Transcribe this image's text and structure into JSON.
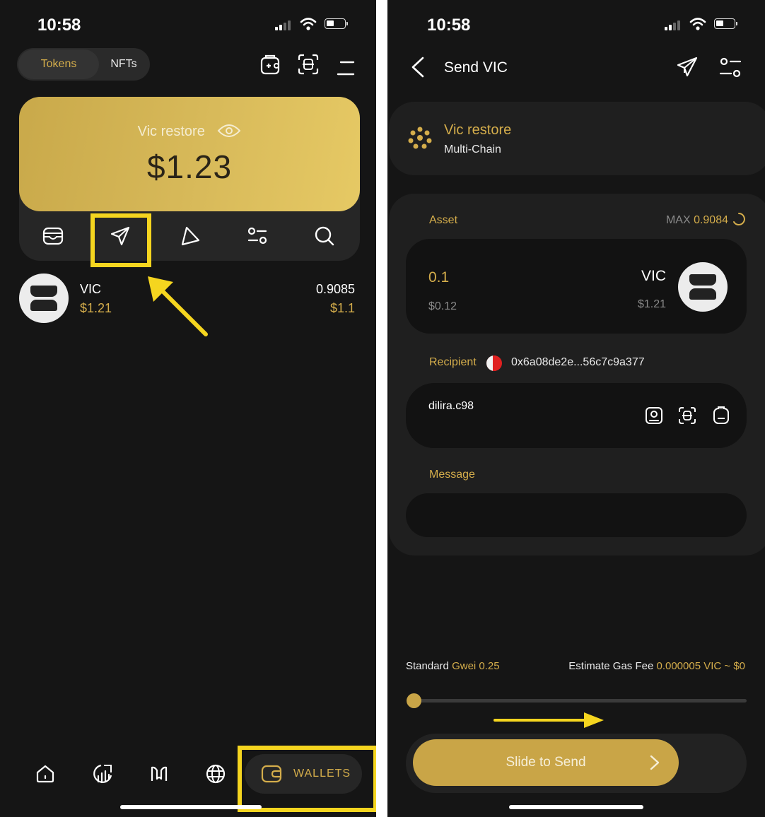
{
  "left_screen": {
    "status": {
      "time": "10:58"
    },
    "tabs": {
      "tokens": "Tokens",
      "nfts": "NFTs"
    },
    "wallet_card": {
      "name": "Vic restore",
      "balance": "$1.23"
    },
    "action_icons": [
      "wallet-icon",
      "send-icon",
      "receive-icon",
      "settings-sliders-icon",
      "search-icon"
    ],
    "token": {
      "symbol": "VIC",
      "price": "$1.21",
      "amount": "0.9085",
      "value": "$1.1"
    },
    "bottom_nav": {
      "wallets_label": "WALLETS",
      "icons": [
        "home-icon",
        "chart-icon",
        "dapp-icon",
        "globe-icon",
        "wallet-icon"
      ]
    }
  },
  "right_screen": {
    "status": {
      "time": "10:58"
    },
    "header": {
      "title": "Send VIC"
    },
    "wallet": {
      "name": "Vic restore",
      "chain": "Multi-Chain"
    },
    "asset": {
      "label": "Asset",
      "max_label": "MAX",
      "max_value": "0.9084",
      "amount": "0.1",
      "amount_usd": "$0.12",
      "symbol": "VIC",
      "price": "$1.21"
    },
    "recipient": {
      "label": "Recipient",
      "address": "0x6a08de2e...56c7c9a377",
      "value": "dilira.c98"
    },
    "message": {
      "label": "Message",
      "value": ""
    },
    "fee": {
      "standard_label": "Standard",
      "gwei_label": "Gwei",
      "gwei_value": "0.25",
      "estimate_label": "Estimate Gas Fee",
      "estimate_value": "0.000005 VIC ~ $0"
    },
    "slide_to_send": "Slide to Send"
  },
  "colors": {
    "accent": "#d4ad4b",
    "highlight": "#f5d51f",
    "background": "#151515"
  }
}
